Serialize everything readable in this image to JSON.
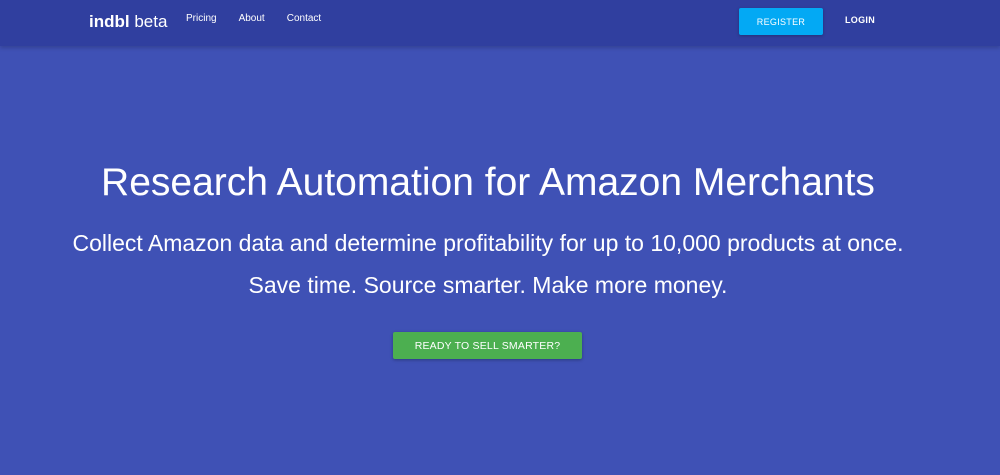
{
  "colors": {
    "page_background": "#3f51b5",
    "navbar_background": "#303f9f",
    "register_button": "#03a9f4",
    "cta_button": "#4caf50",
    "text": "#ffffff"
  },
  "navbar": {
    "brand_name": "indbl",
    "brand_tag": "beta",
    "links": [
      "Pricing",
      "About",
      "Contact"
    ],
    "register_label": "REGISTER",
    "login_label": "LOGIN"
  },
  "hero": {
    "title": "Research Automation for Amazon Merchants",
    "subtitle_line1": "Collect Amazon data and determine profitability for up to 10,000 products at once.",
    "subtitle_line2": "Save time. Source smarter. Make more money.",
    "cta_label": "READY TO SELL SMARTER?"
  }
}
